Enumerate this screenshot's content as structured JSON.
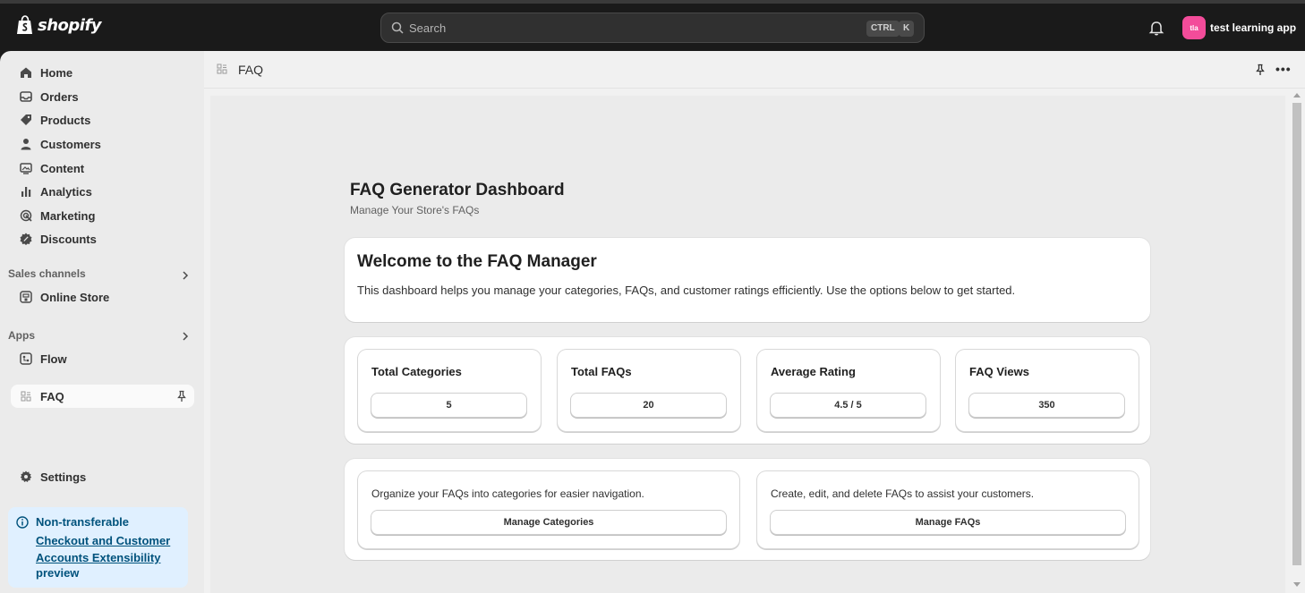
{
  "topbar": {
    "logo_text": "shopify",
    "search_placeholder": "Search",
    "kbd_ctrl": "CTRL",
    "kbd_k": "K",
    "account_initials": "tla",
    "account_name": "test learning app"
  },
  "sidebar": {
    "items": [
      {
        "label": "Home",
        "icon": "home-icon"
      },
      {
        "label": "Orders",
        "icon": "inbox-icon"
      },
      {
        "label": "Products",
        "icon": "tag-icon"
      },
      {
        "label": "Customers",
        "icon": "person-icon"
      },
      {
        "label": "Content",
        "icon": "image-icon"
      },
      {
        "label": "Analytics",
        "icon": "bar-chart-icon"
      },
      {
        "label": "Marketing",
        "icon": "target-icon"
      },
      {
        "label": "Discounts",
        "icon": "discount-icon"
      }
    ],
    "sales_channels_label": "Sales channels",
    "online_store_label": "Online Store",
    "apps_label": "Apps",
    "flow_label": "Flow",
    "faq_label": "FAQ",
    "settings_label": "Settings",
    "notice": {
      "line1": "Non-transferable",
      "link": "Checkout and Customer Accounts Extensibility",
      "line3": "preview"
    }
  },
  "main": {
    "header_title": "FAQ",
    "more_label": "•••",
    "dashboard_title": "FAQ Generator Dashboard",
    "dashboard_subtitle": "Manage Your Store's FAQs",
    "welcome_title": "Welcome to the FAQ Manager",
    "welcome_text": "This dashboard helps you manage your categories, FAQs, and customer ratings efficiently. Use the options below to get started.",
    "stats": [
      {
        "label": "Total Categories",
        "value": "5"
      },
      {
        "label": "Total FAQs",
        "value": "20"
      },
      {
        "label": "Average Rating",
        "value": "4.5 / 5"
      },
      {
        "label": "FAQ Views",
        "value": "350"
      }
    ],
    "actions": [
      {
        "description": "Organize your FAQs into categories for easier navigation.",
        "button": "Manage Categories"
      },
      {
        "description": "Create, edit, and delete FAQs to assist your customers.",
        "button": "Manage FAQs"
      }
    ]
  },
  "colors": {
    "topbar_bg": "#1a1a1a",
    "sidebar_bg": "#ebebeb",
    "avatar_bg": "#f34c9a",
    "notice_bg": "#e0f0ff",
    "notice_text": "#00527c"
  }
}
